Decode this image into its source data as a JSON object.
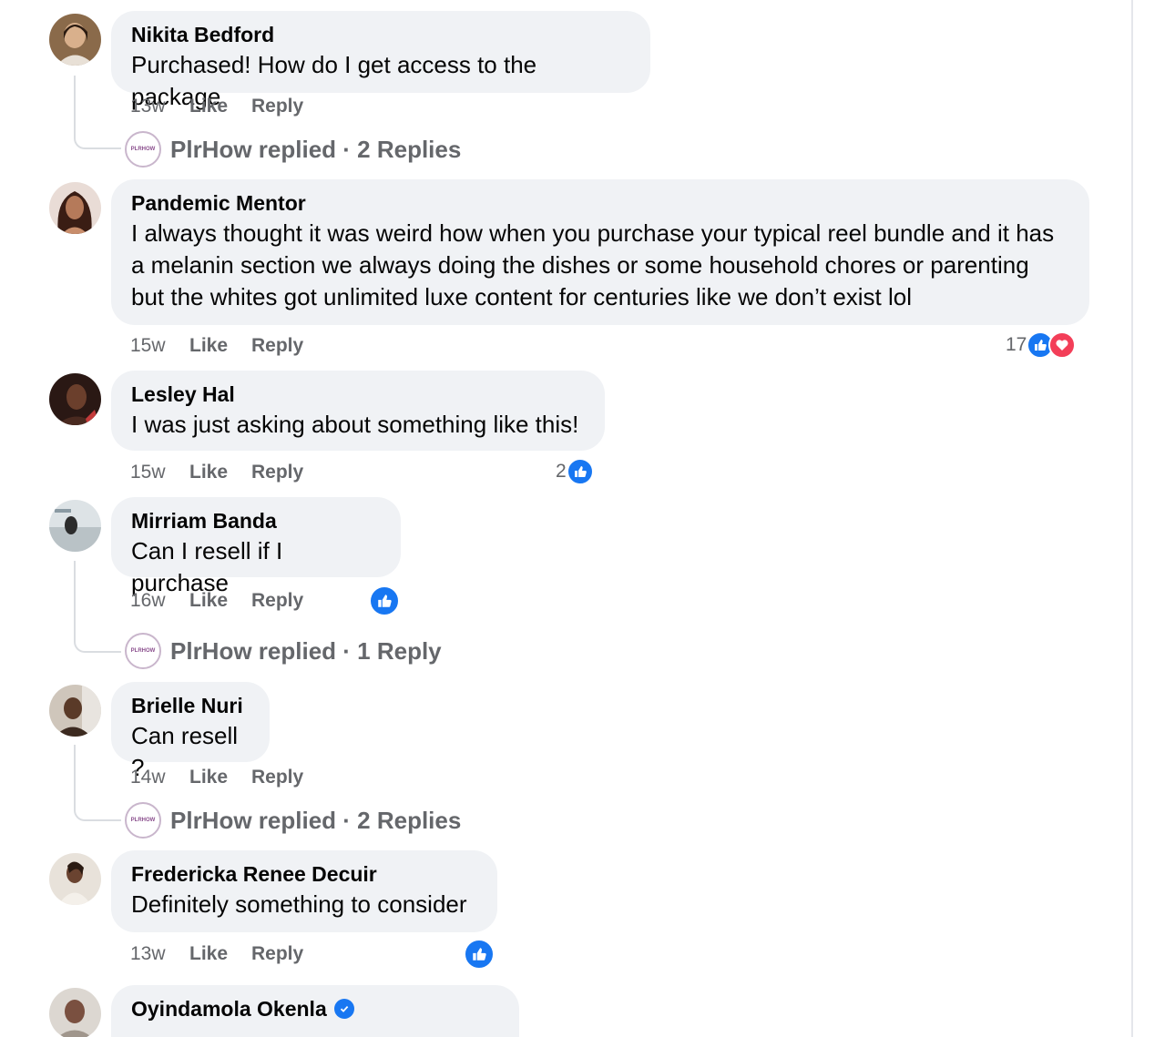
{
  "comments": [
    {
      "name": "Nikita Bedford",
      "text": "Purchased! How do I get access to the package",
      "time": "13w",
      "like": "Like",
      "reply": "Reply",
      "replies": "PlrHow replied · 2 Replies",
      "reaction_count": ""
    },
    {
      "name": "Pandemic Mentor",
      "text_lines": [
        "I always thought it was weird how when you purchase your typical reel bundle and it has",
        "a melanin section we always doing the dishes or some household chores or parenting",
        "but the whites got unlimited luxe content for centuries like we don’t exist lol"
      ],
      "time": "15w",
      "like": "Like",
      "reply": "Reply",
      "reaction_count": "17"
    },
    {
      "name": "Lesley Hal",
      "text": "I was just asking about something like this!",
      "time": "15w",
      "like": "Like",
      "reply": "Reply",
      "reaction_count": "2"
    },
    {
      "name": "Mirriam Banda",
      "text": "Can I resell if I purchase",
      "time": "16w",
      "like": "Like",
      "reply": "Reply",
      "replies": "PlrHow replied · 1 Reply"
    },
    {
      "name": "Brielle Nuri",
      "text": "Can resell ?",
      "time": "14w",
      "like": "Like",
      "reply": "Reply",
      "replies": "PlrHow replied · 2 Replies"
    },
    {
      "name": "Fredericka Renee Decuir",
      "text": "Definitely something to consider",
      "time": "13w",
      "like": "Like",
      "reply": "Reply"
    },
    {
      "name": "Oyindamola Okenla",
      "verified": true
    }
  ],
  "colors": {
    "bubble": "#f0f2f5",
    "meta": "#65676b",
    "like_blue": "#1877f2",
    "love_red": "#f33e58"
  },
  "icons": {
    "like": "thumbs-up-icon",
    "love": "heart-icon",
    "verified": "verified-badge-icon"
  }
}
